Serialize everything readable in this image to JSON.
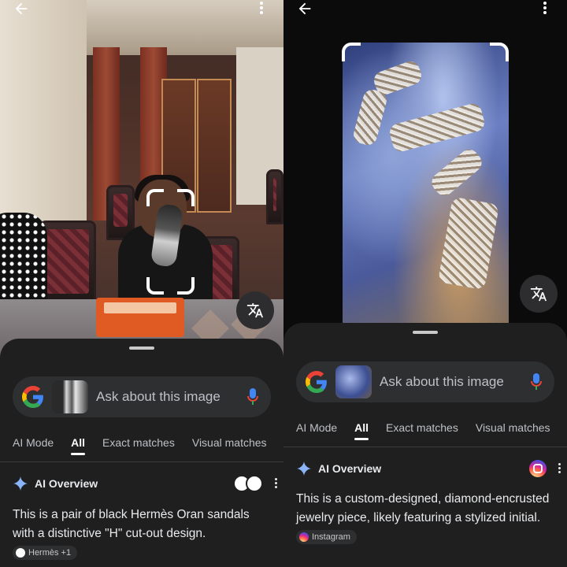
{
  "left": {
    "search": {
      "placeholder": "Ask about this image"
    },
    "tabs": [
      {
        "label": "AI Mode",
        "active": false
      },
      {
        "label": "All",
        "active": true
      },
      {
        "label": "Exact matches",
        "active": false
      },
      {
        "label": "Visual matches",
        "active": false
      }
    ],
    "overview": {
      "title": "AI Overview",
      "text": "This is a pair of black Hermès Oran sandals with a distinctive \"H\" cut-out design.",
      "source_chip": "Hermès +1"
    },
    "icons": {
      "back": "arrow-back-icon",
      "menu": "more-vert-icon",
      "translate": "translate-icon",
      "mic": "mic-icon",
      "sparkle": "ai-sparkle-icon"
    }
  },
  "right": {
    "search": {
      "placeholder": "Ask about this image"
    },
    "tabs": [
      {
        "label": "AI Mode",
        "active": false
      },
      {
        "label": "All",
        "active": true
      },
      {
        "label": "Exact matches",
        "active": false
      },
      {
        "label": "Visual matches",
        "active": false
      }
    ],
    "overview": {
      "title": "AI Overview",
      "text": "This is a custom-designed, diamond-encrusted jewelry piece, likely featuring a stylized initial.",
      "source_chip": "Instagram"
    }
  },
  "colors": {
    "sheet_bg": "#1f1f1f",
    "searchbar_bg": "#2e2f31",
    "text_primary": "#e8eaed",
    "text_secondary": "#bdc1c6",
    "google_blue": "#4285f4",
    "google_red": "#ea4335",
    "google_yellow": "#fbbc05",
    "google_green": "#34a853"
  }
}
